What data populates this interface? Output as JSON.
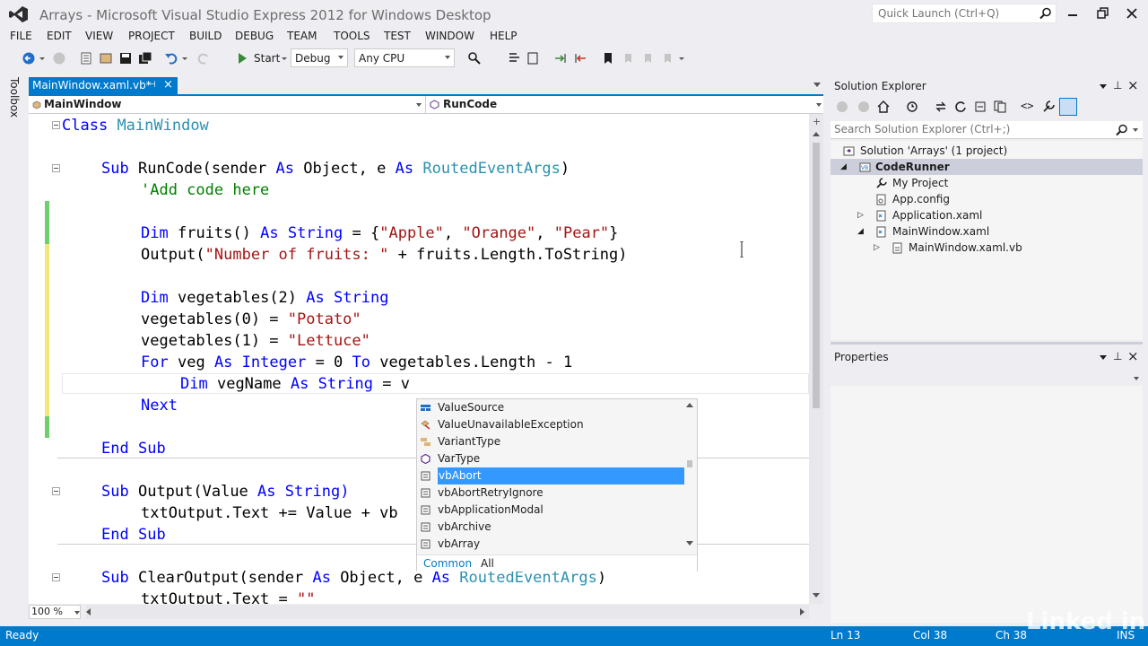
{
  "window": {
    "title": "Arrays - Microsoft Visual Studio Express 2012 for Windows Desktop",
    "quick_launch_placeholder": "Quick Launch (Ctrl+Q)"
  },
  "menu": [
    "FILE",
    "EDIT",
    "VIEW",
    "PROJECT",
    "BUILD",
    "DEBUG",
    "TEAM",
    "TOOLS",
    "TEST",
    "WINDOW",
    "HELP"
  ],
  "toolbar": {
    "start_label": "Start",
    "config": "Debug",
    "platform": "Any CPU"
  },
  "toolbox_label": "Toolbox",
  "editor": {
    "tab_label": "MainWindow.xaml.vb*",
    "nav_left": "MainWindow",
    "nav_right": "RunCode",
    "zoom": "100 %",
    "code": {
      "l1": [
        "Class",
        "MainWindow"
      ],
      "l3": [
        "Sub",
        "RunCode(sender",
        "As",
        "Object, e",
        "As",
        "RoutedEventArgs",
        ")"
      ],
      "l4": "'Add code here",
      "l6": [
        "Dim",
        "fruits()",
        "As",
        "String",
        "= {",
        "\"Apple\"",
        ", ",
        "\"Orange\"",
        ", ",
        "\"Pear\"",
        "}"
      ],
      "l7": [
        "Output(",
        "\"Number of fruits: \"",
        " + fruits.Length.ToString)"
      ],
      "l9": [
        "Dim",
        "vegetables(2)",
        "As",
        "String"
      ],
      "l10": [
        "vegetables(0) = ",
        "\"Potato\""
      ],
      "l11": [
        "vegetables(1) = ",
        "\"Lettuce\""
      ],
      "l12": [
        "For",
        "veg",
        "As",
        "Integer",
        "= 0",
        "To",
        "vegetables.Length - 1"
      ],
      "l13": [
        "Dim",
        "vegName",
        "As",
        "String",
        "= v"
      ],
      "l14": "Next",
      "l16": [
        "End",
        "Sub"
      ],
      "l18": [
        "Sub",
        "Output(Value",
        "As",
        "String)"
      ],
      "l19": "txtOutput.Text += Value + vb",
      "l20": [
        "End",
        "Sub"
      ],
      "l22": [
        "Sub",
        "ClearOutput(sender",
        "As",
        "Object, e",
        "As",
        "RoutedEventArgs",
        ")"
      ],
      "l23": [
        "txtOutput.Text = ",
        "\"\""
      ]
    }
  },
  "autocomplete": {
    "items": [
      {
        "label": "ValueSource",
        "icon": "enum-icon"
      },
      {
        "label": "ValueUnavailableException",
        "icon": "class-icon"
      },
      {
        "label": "VariantType",
        "icon": "enum-icon"
      },
      {
        "label": "VarType",
        "icon": "method-icon"
      },
      {
        "label": "vbAbort",
        "icon": "constant-icon",
        "selected": true
      },
      {
        "label": "vbAbortRetryIgnore",
        "icon": "constant-icon"
      },
      {
        "label": "vbApplicationModal",
        "icon": "constant-icon"
      },
      {
        "label": "vbArchive",
        "icon": "constant-icon"
      },
      {
        "label": "vbArray",
        "icon": "constant-icon"
      }
    ],
    "tab_common": "Common",
    "tab_all": "All"
  },
  "solution_explorer": {
    "title": "Solution Explorer",
    "search_placeholder": "Search Solution Explorer (Ctrl+;)",
    "items": [
      {
        "label": "Solution 'Arrays' (1 project)"
      },
      {
        "label": "CodeRunner"
      },
      {
        "label": "My Project"
      },
      {
        "label": "App.config"
      },
      {
        "label": "Application.xaml"
      },
      {
        "label": "MainWindow.xaml"
      },
      {
        "label": "MainWindow.xaml.vb"
      }
    ]
  },
  "properties": {
    "title": "Properties"
  },
  "status": {
    "ready": "Ready",
    "ln": "Ln 13",
    "col": "Col 38",
    "ch": "Ch 38",
    "ins": "INS"
  },
  "watermark": "Linked in",
  "colors": {
    "accent": "#007acc",
    "keyword": "#0000ff",
    "type": "#2b91af",
    "string": "#a31515",
    "comment": "#008000",
    "selection": "#3399ff"
  }
}
